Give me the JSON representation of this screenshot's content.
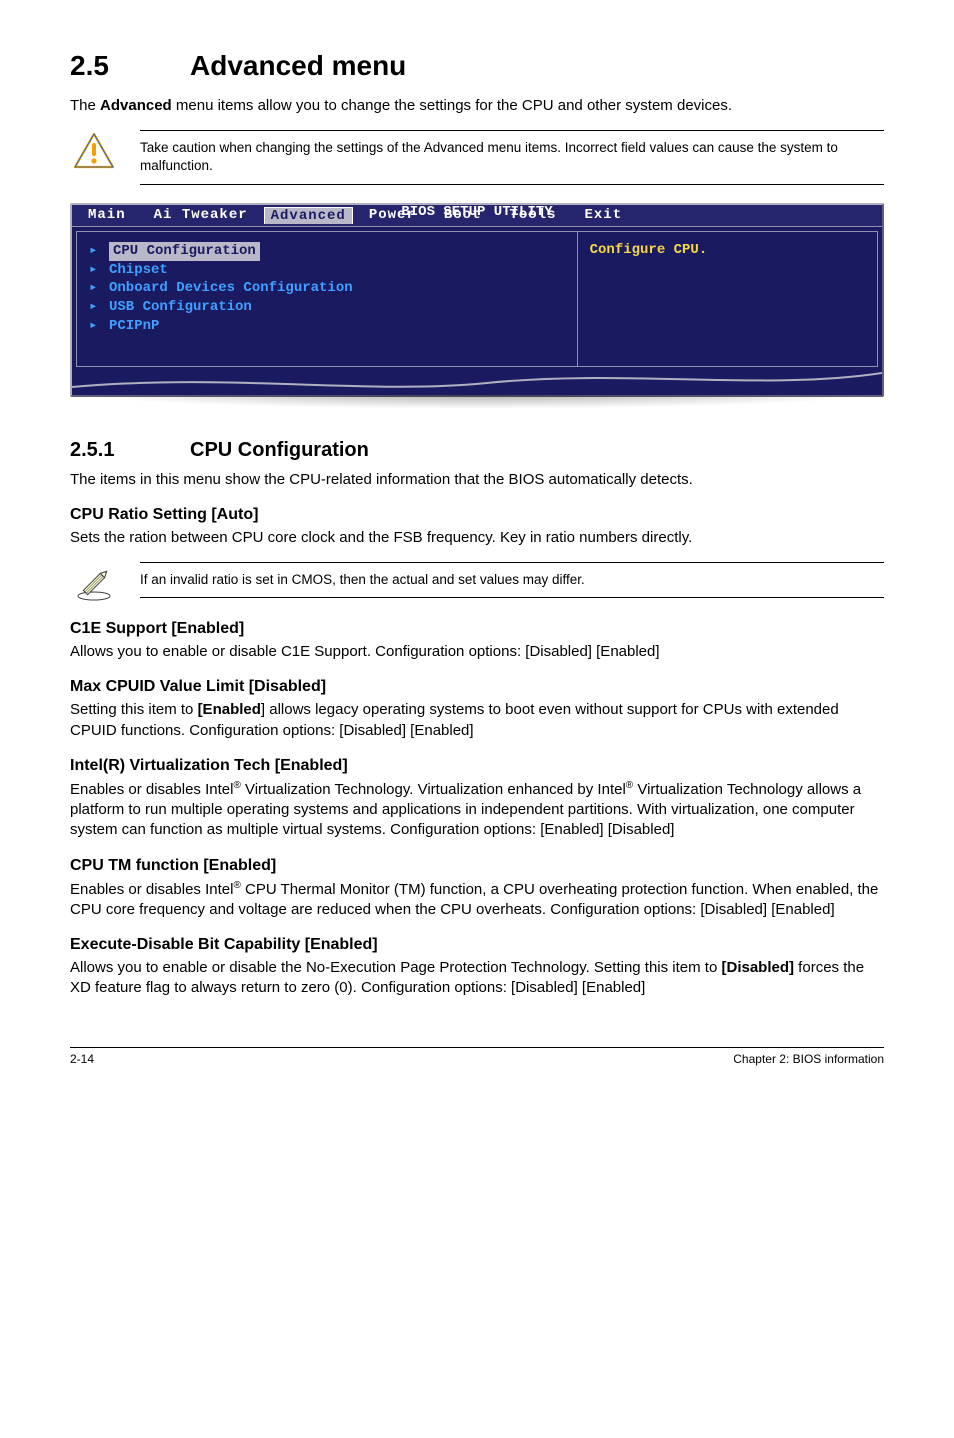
{
  "section": {
    "number": "2.5",
    "title": "Advanced menu",
    "intro_pre": "The ",
    "intro_bold": "Advanced",
    "intro_post": " menu items allow you to change the settings for the CPU and other system devices."
  },
  "caution_note": "Take caution when changing the settings of the Advanced menu items. Incorrect field values can cause the system to malfunction.",
  "bios": {
    "caption": "BIOS SETUP UTILITY",
    "tabs": [
      "Main",
      "Ai Tweaker",
      "Advanced",
      "Power",
      "Boot",
      "Tools",
      "Exit"
    ],
    "active_tab_index": 2,
    "left_items": [
      "CPU Configuration",
      "Chipset",
      "Onboard Devices Configuration",
      "USB Configuration",
      "PCIPnP"
    ],
    "selected_left_index": 0,
    "right_hint": "Configure CPU."
  },
  "subsection": {
    "number": "2.5.1",
    "title": "CPU Configuration",
    "intro": "The items in this menu show the CPU-related information that the BIOS automatically detects."
  },
  "options": {
    "cpu_ratio": {
      "heading": "CPU Ratio Setting [Auto]",
      "body": "Sets the ration between CPU core clock and the FSB frequency. Key in ratio numbers directly."
    },
    "pencil_note": "If an invalid ratio is set in CMOS, then the actual and set values may differ.",
    "c1e": {
      "heading": "C1E Support [Enabled]",
      "body": "Allows you to enable or disable C1E Support. Configuration options: [Disabled] [Enabled]"
    },
    "max_cpuid": {
      "heading": "Max CPUID Value Limit [Disabled]",
      "body_pre": "Setting this item to ",
      "body_bold": "[Enabled",
      "body_post": "] allows legacy operating systems to boot even without support for CPUs with extended CPUID functions. Configuration options: [Disabled] [Enabled]"
    },
    "vt": {
      "heading": "Intel(R) Virtualization Tech [Enabled]",
      "body_l1a": "Enables or disables Intel",
      "body_l1b": " Virtualization Technology. Virtualization enhanced by Intel",
      "body_l2": " Virtualization Technology allows a platform to run multiple operating systems and applications in independent partitions. With virtualization, one computer system can function as multiple virtual systems. Configuration options: [Enabled] [Disabled]"
    },
    "tm": {
      "heading": "CPU TM function [Enabled]",
      "body_pre": "Enables or disables Intel",
      "body_post": " CPU Thermal Monitor (TM) function, a CPU overheating  protection function. When enabled, the CPU core frequency and voltage are reduced when the CPU overheats. Configuration options: [Disabled] [Enabled]"
    },
    "xd": {
      "heading": "Execute-Disable Bit Capability [Enabled]",
      "body_pre": "Allows you to enable or disable the No-Execution Page Protection Technology. Setting this item to ",
      "body_bold": "[Disabled]",
      "body_post": " forces the XD feature flag to always return to zero (0). Configuration options: [Disabled] [Enabled]"
    }
  },
  "reg_mark": "®",
  "footer": {
    "left": "2-14",
    "right": "Chapter 2: BIOS information"
  }
}
